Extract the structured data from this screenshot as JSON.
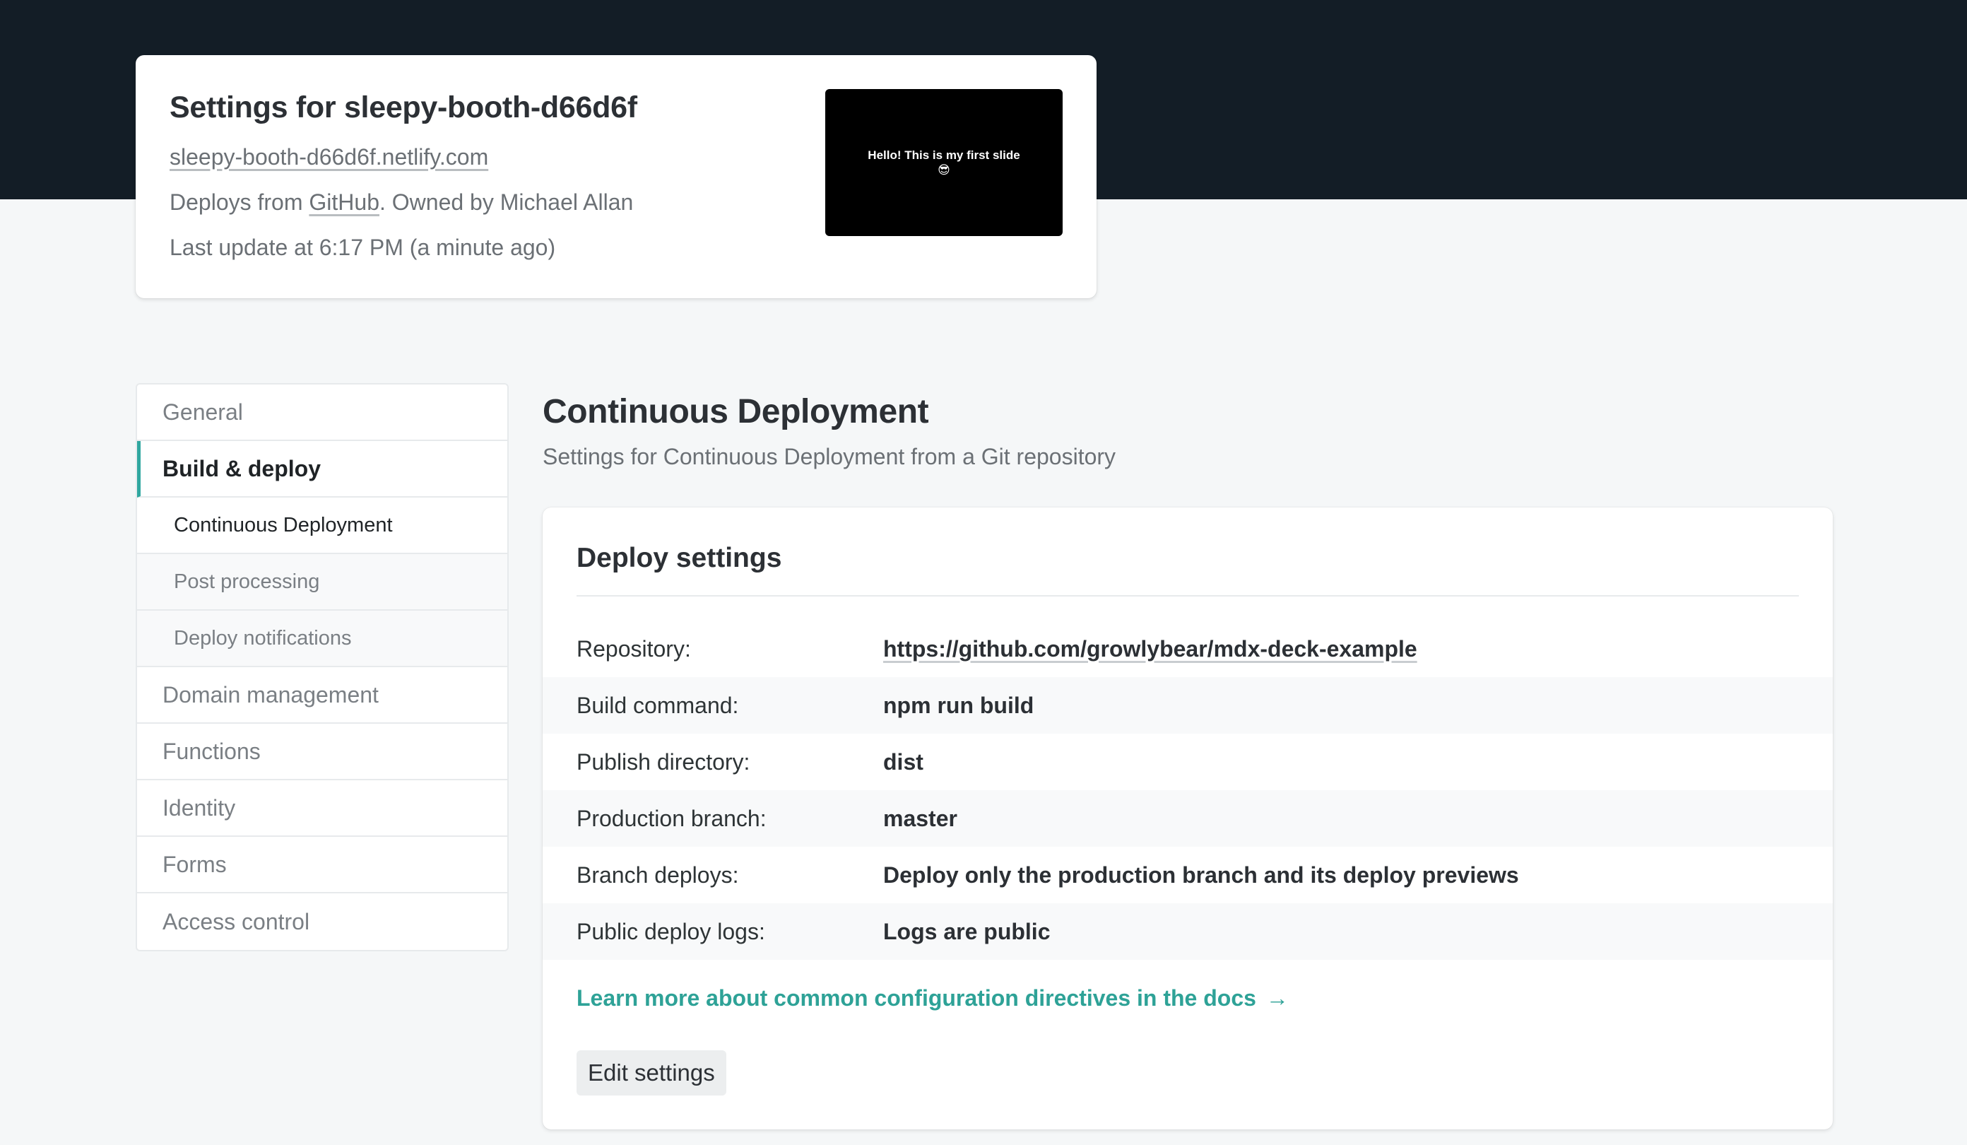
{
  "site": {
    "title": "Settings for sleepy-booth-d66d6f",
    "url": "sleepy-booth-d66d6f.netlify.com",
    "deploys_prefix": "Deploys from ",
    "deploys_source": "GitHub",
    "owned_prefix": ". Owned by ",
    "owner": "Michael Allan",
    "last_update": "Last update at 6:17 PM (a minute ago)",
    "preview_text": "Hello! This is my first slide 😎"
  },
  "sidebar": {
    "items": [
      {
        "label": "General"
      },
      {
        "label": "Build & deploy"
      },
      {
        "label": "Continuous Deployment"
      },
      {
        "label": "Post processing"
      },
      {
        "label": "Deploy notifications"
      },
      {
        "label": "Domain management"
      },
      {
        "label": "Functions"
      },
      {
        "label": "Identity"
      },
      {
        "label": "Forms"
      },
      {
        "label": "Access control"
      }
    ]
  },
  "main": {
    "title": "Continuous Deployment",
    "subtitle": "Settings for Continuous Deployment from a Git repository",
    "card": {
      "title": "Deploy settings",
      "rows": [
        {
          "label": "Repository:",
          "value": "https://github.com/growlybear/mdx-deck-example"
        },
        {
          "label": "Build command:",
          "value": "npm run build"
        },
        {
          "label": "Publish directory:",
          "value": "dist"
        },
        {
          "label": "Production branch:",
          "value": "master"
        },
        {
          "label": "Branch deploys:",
          "value": "Deploy only the production branch and its deploy previews"
        },
        {
          "label": "Public deploy logs:",
          "value": "Logs are public"
        }
      ],
      "docs_link": "Learn more about common configuration directives in the docs",
      "docs_arrow": "→",
      "edit_button": "Edit settings"
    }
  },
  "colors": {
    "header_bg": "#131d26",
    "accent": "#30a7a0",
    "link": "#2ea297"
  }
}
